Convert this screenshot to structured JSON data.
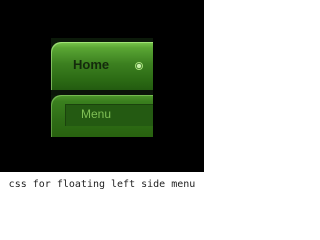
{
  "menu": {
    "items": [
      {
        "label": "Home",
        "icon": "radio-dot-icon",
        "state": "active"
      },
      {
        "label": "Menu",
        "state": "normal"
      }
    ]
  },
  "caption": "css for floating left side menu",
  "colors": {
    "background": "#000000",
    "menu_green": "#3c8020",
    "home_label": "#142a0c",
    "menu_label": "#7fbf55"
  }
}
